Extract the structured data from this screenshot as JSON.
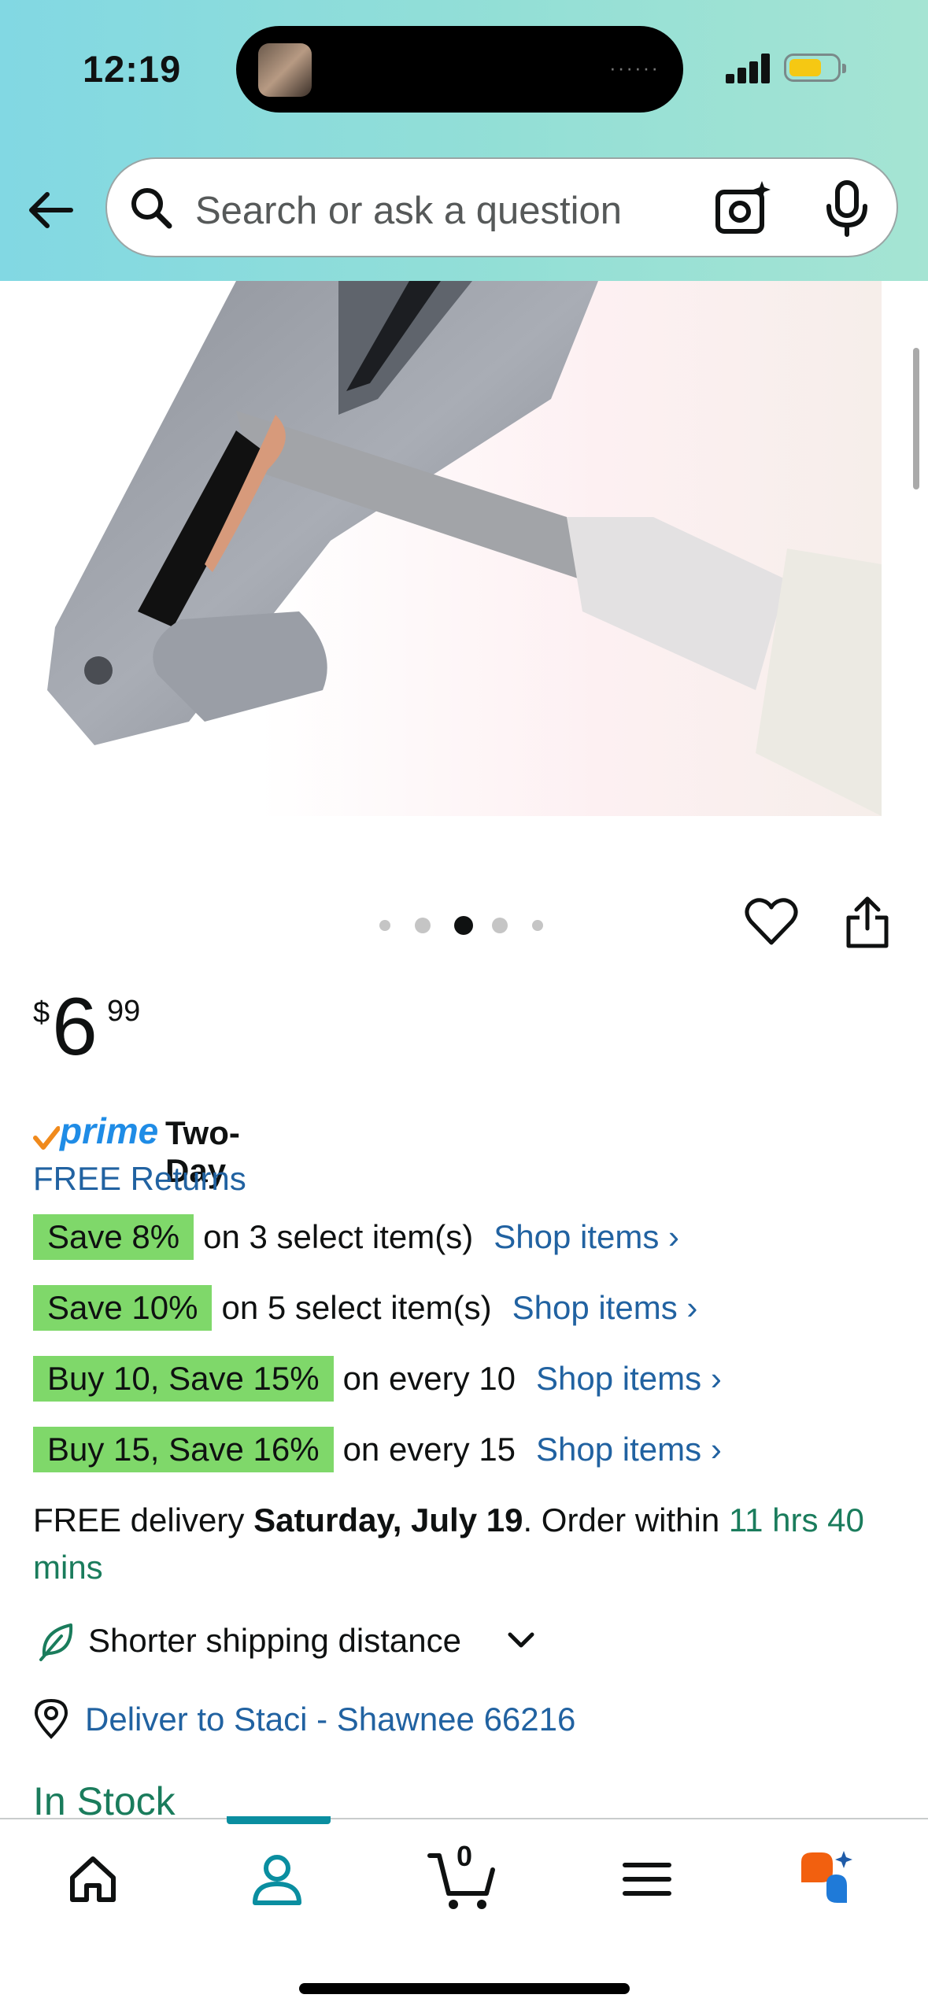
{
  "status_bar": {
    "time": "12:19",
    "battery_color": "#f5c813"
  },
  "header": {
    "back_icon": "back-arrow-icon",
    "search_placeholder": "Search or ask a question",
    "camera_icon": "camera-search-icon",
    "mic_icon": "microphone-icon",
    "gradient": [
      "#82d8e3",
      "#a5e4d3"
    ]
  },
  "product": {
    "image_description_icon": "product-image",
    "pager": {
      "total": 5,
      "active_index": 2
    },
    "price": {
      "currency": "$",
      "whole": "6",
      "fraction": "99"
    },
    "prime": {
      "logo_text": "prime",
      "label": "Two-Day"
    },
    "returns": "FREE Returns",
    "deals": [
      {
        "badge": "Save 8%",
        "text": "on 3 select item(s)",
        "link": "Shop items ›"
      },
      {
        "badge": "Save 10%",
        "text": "on 5 select item(s)",
        "link": "Shop items ›"
      },
      {
        "badge": "Buy 10, Save 15%",
        "text": "on every 10",
        "link": "Shop items ›"
      },
      {
        "badge": "Buy 15, Save 16%",
        "text": "on every 15",
        "link": "Shop items ›"
      }
    ],
    "delivery": {
      "prefix": "FREE delivery ",
      "date": "Saturday, July 19",
      "middle": ". Order within ",
      "countdown": "11 hrs 40 mins"
    },
    "shipping": "Shorter shipping distance",
    "deliver_to": "Deliver to Staci - Shawnee 66216",
    "stock": "In Stock"
  },
  "tabbar": {
    "tabs": [
      {
        "name": "home",
        "icon": "home-icon"
      },
      {
        "name": "account",
        "icon": "person-icon",
        "active": true
      },
      {
        "name": "cart",
        "icon": "cart-icon",
        "count": "0"
      },
      {
        "name": "menu",
        "icon": "menu-icon"
      },
      {
        "name": "rufus",
        "icon": "rufus-chat-icon"
      }
    ],
    "active_color": "#0a8ea0"
  }
}
